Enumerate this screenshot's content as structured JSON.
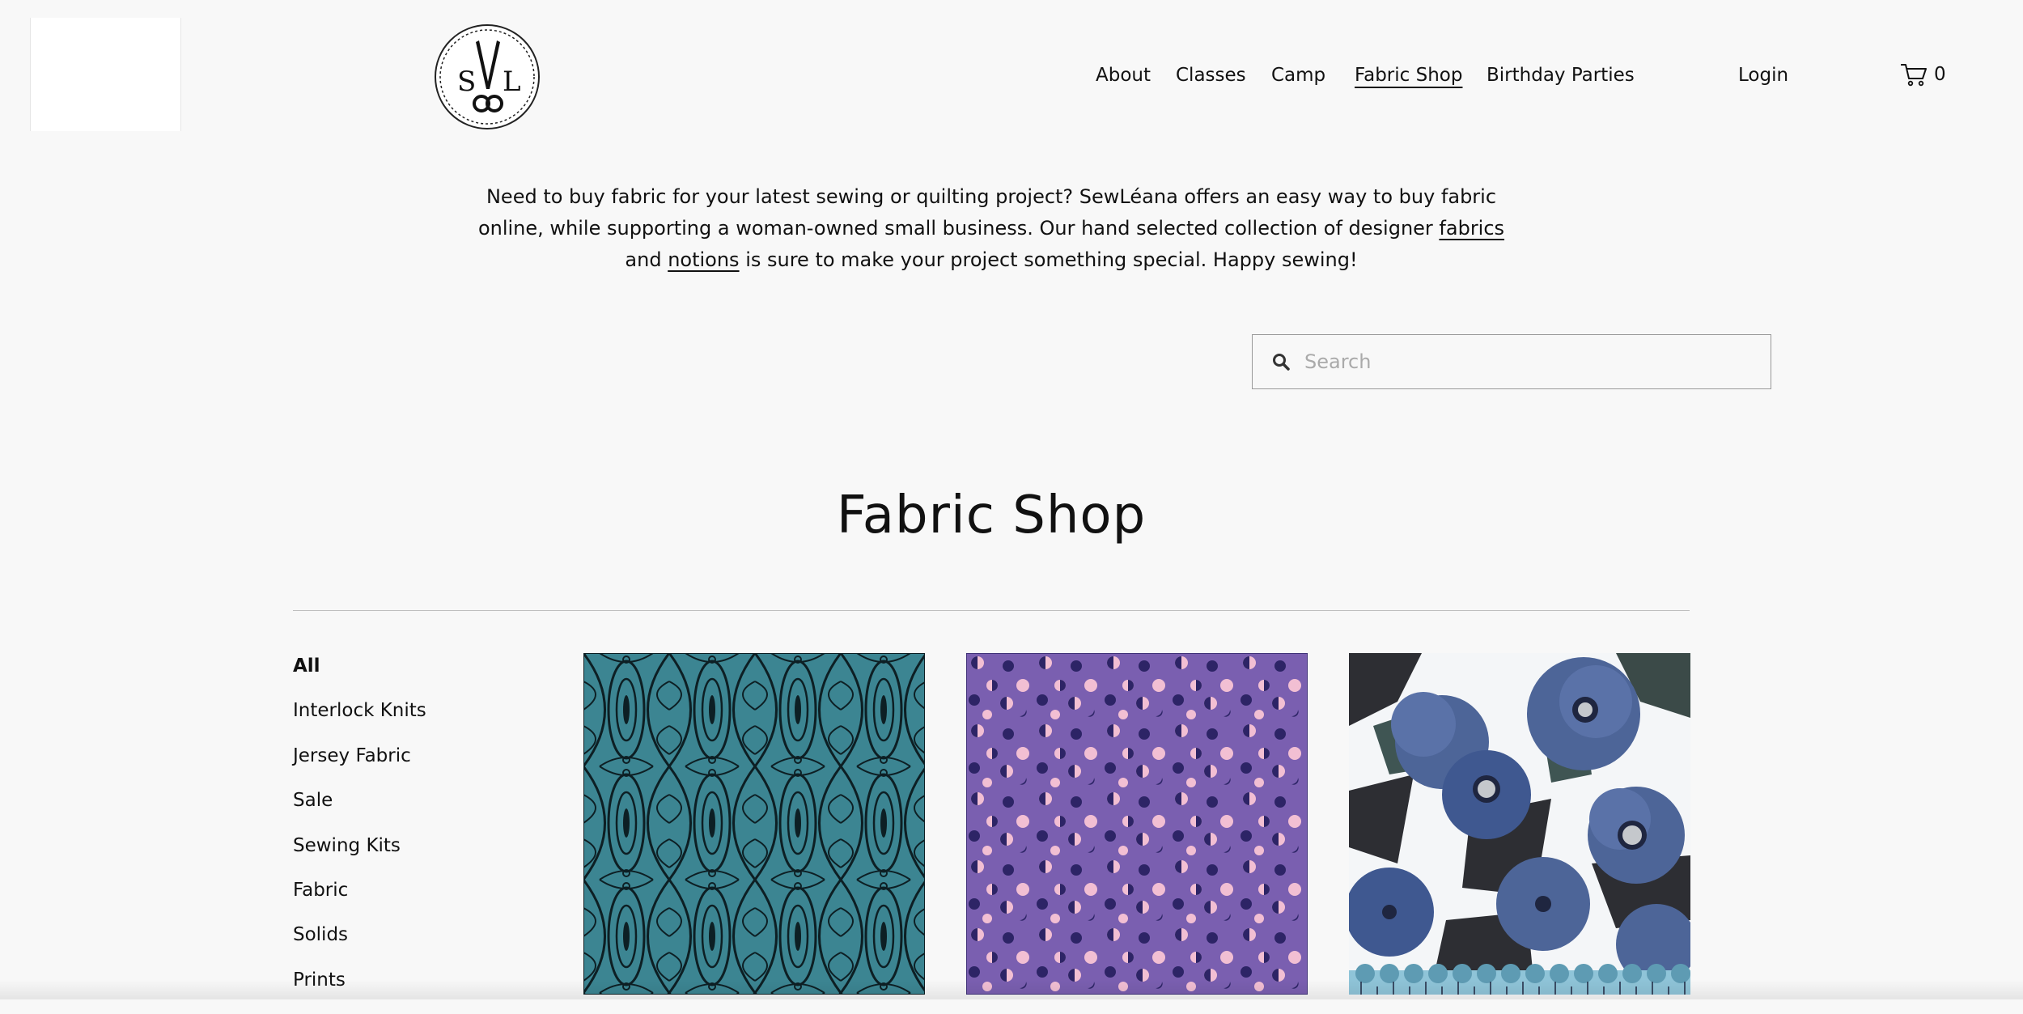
{
  "header": {
    "nav": [
      {
        "label": "About"
      },
      {
        "label": "Classes"
      },
      {
        "label": "Camp"
      },
      {
        "label": "Fabric Shop"
      },
      {
        "label": "Birthday Parties"
      }
    ],
    "active_nav": "Fabric Shop",
    "login_label": "Login",
    "cart_count": "0",
    "logo_text": "SL"
  },
  "intro": {
    "part1": "Need to buy fabric for your latest sewing or quilting project? SewLéana offers an easy way to buy fabric online, while supporting a woman-owned small business. Our hand selected collection of designer ",
    "link_fabrics": "fabrics",
    "part2": " and ",
    "link_notions": "notions",
    "part3": " is sure to make your project something special. Happy sewing!"
  },
  "search": {
    "placeholder": "Search"
  },
  "page_title": "Fabric Shop",
  "categories": [
    {
      "label": "All"
    },
    {
      "label": "Interlock Knits"
    },
    {
      "label": "Jersey Fabric"
    },
    {
      "label": "Sale"
    },
    {
      "label": "Sewing Kits"
    },
    {
      "label": "Fabric"
    },
    {
      "label": "Solids"
    },
    {
      "label": "Prints"
    }
  ],
  "active_category": "All",
  "colors": {
    "background": "#f8f8f8",
    "text": "#111111",
    "teal_fabric": "#3c8592",
    "purple_fabric": "#7a5fb0",
    "purple_dots_pink": "#f2bfd3",
    "purple_dots_navy": "#2d2466",
    "floral_blue": "#4d6598",
    "floral_dark": "#2d2e33"
  },
  "products": [
    {
      "icon": "teal-lace-fabric"
    },
    {
      "icon": "purple-dots-fabric"
    },
    {
      "icon": "blue-poppy-fabric"
    }
  ]
}
